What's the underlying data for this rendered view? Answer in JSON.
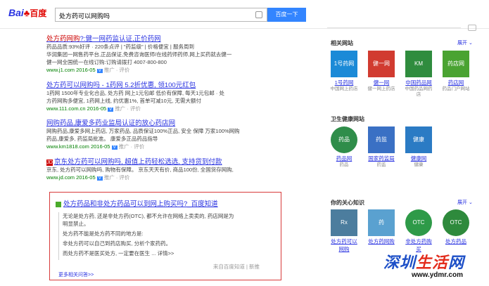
{
  "logo": {
    "bai": "Bai",
    "paw": "♣",
    "du": "百度"
  },
  "search": {
    "query": "处方药可以网购吗",
    "button": "百度一下"
  },
  "results": [
    {
      "title_prefix": "处方药网购",
      "title_rest": "?:健一网药监认证,正价药网",
      "desc1": "药品品质:93%好评 · 220条点评 | \"药监级\" | 价格便宜 | 服务周到",
      "desc2": "华润集团一网售药平台,正品保证,免费咨询医师/在线药师药师,网上买药就去健一",
      "desc3": "健一网全国统一在线订购:订购请拨打 4007-800-800",
      "url": "www.j1.com",
      "date": "2016-05",
      "tail": "推广 · 评价"
    },
    {
      "title": "处方药可以网购吗 - 1药网 5.2折优惠, 领100元红包",
      "desc1": "1药网 1500年专业化合品, 处方药 网上1元包邮 低价有保障, 每天1元包邮 · 处",
      "desc2": "方药网购多便宜, 1药网上线, 约优惠1%, 首单可减10元, 无需大额付",
      "url": "www.111.com.cn",
      "date": "2016-05",
      "tail": "推广 · 评价"
    },
    {
      "title": "网购药品,康爱多药业监局认证的放心药店网",
      "desc1": "网购药品,康爱多网上药店, 万家药品, 品质保证100%正品, 安全 保障 万家100%网购",
      "desc2": "药品,康爱多, 药监局批准。 康爱多正品药品指导",
      "url": "www.km1818.com",
      "date": "2016-05",
      "tail": "推广 · 评价"
    },
    {
      "badge": "JD",
      "title": "京东处方药可以网购吗, 超值上药轻松选选, 支持货到付款",
      "desc1": "京东, 处方药可以网购吗, 购物有保障。 京东天天有价, 商品100份, 全国货存网购,",
      "desc2": "",
      "url": "www.jd.com",
      "date": "2016-05",
      "tail": "推广 · 评价"
    }
  ],
  "zhidao": {
    "title": "处方药品和非处方药品可以到网上购买吗?_百度知道",
    "lines": [
      "无论是处方药, 还是非处方药(OTC), 都不允许在网络上卖卖的, 药店网是为",
      "明显禁止。",
      "处方药不能是处方药不同的地方是:",
      "非处方药可以自己到药店购买, 分析个家药药。",
      "而处方药不是医买处方, 一定要在医生 ... 详情>>"
    ],
    "meta": "来自百度知道 | 新推",
    "more": "更多相关问答>>"
  },
  "sidebar": {
    "sec1": {
      "title": "相关网站",
      "more": "展开",
      "items": [
        {
          "name": "1号药网",
          "sub": "中国网上药店",
          "color": "#1b8ad7",
          "label": "1号药网"
        },
        {
          "name": "健一网",
          "sub": "健一网上药店",
          "color": "#d13b30",
          "label": "健一网"
        },
        {
          "name": "中国药品网",
          "sub": "中国药品网药店",
          "color": "#2f8c3e",
          "label": "KM"
        },
        {
          "name": "药店网",
          "sub": "药品门户网站",
          "color": "#4aa331",
          "label": "药店网"
        }
      ]
    },
    "sec2": {
      "title": "卫生健康网站",
      "items": [
        {
          "name": "药品网",
          "sub": "药品",
          "color": "#2f8d4a",
          "label": "药品"
        },
        {
          "name": "国家药监局",
          "sub": "药监",
          "color": "#3a70c4",
          "label": "药监"
        },
        {
          "name": "健康网",
          "sub": "健康",
          "color": "#2b7bc4",
          "label": "健康"
        }
      ]
    },
    "sec3": {
      "title": "你的关心知识",
      "more": "展开",
      "items": [
        {
          "name": "处方药可以网购",
          "sub": "",
          "color": "#4c7d9e",
          "label": "Rx"
        },
        {
          "name": "处方药网购",
          "sub": "",
          "color": "#5aa1d0",
          "label": "药"
        },
        {
          "name": "非处方药购买",
          "sub": "",
          "color": "#2e9a48",
          "label": "OTC"
        },
        {
          "name": "处方药品",
          "sub": "",
          "color": "#2e8a3c",
          "label": "OTC"
        }
      ]
    }
  },
  "watermark": {
    "text1": "深圳",
    "text2": "生活",
    "text3": "网",
    "url": "www.ydmr.com"
  }
}
